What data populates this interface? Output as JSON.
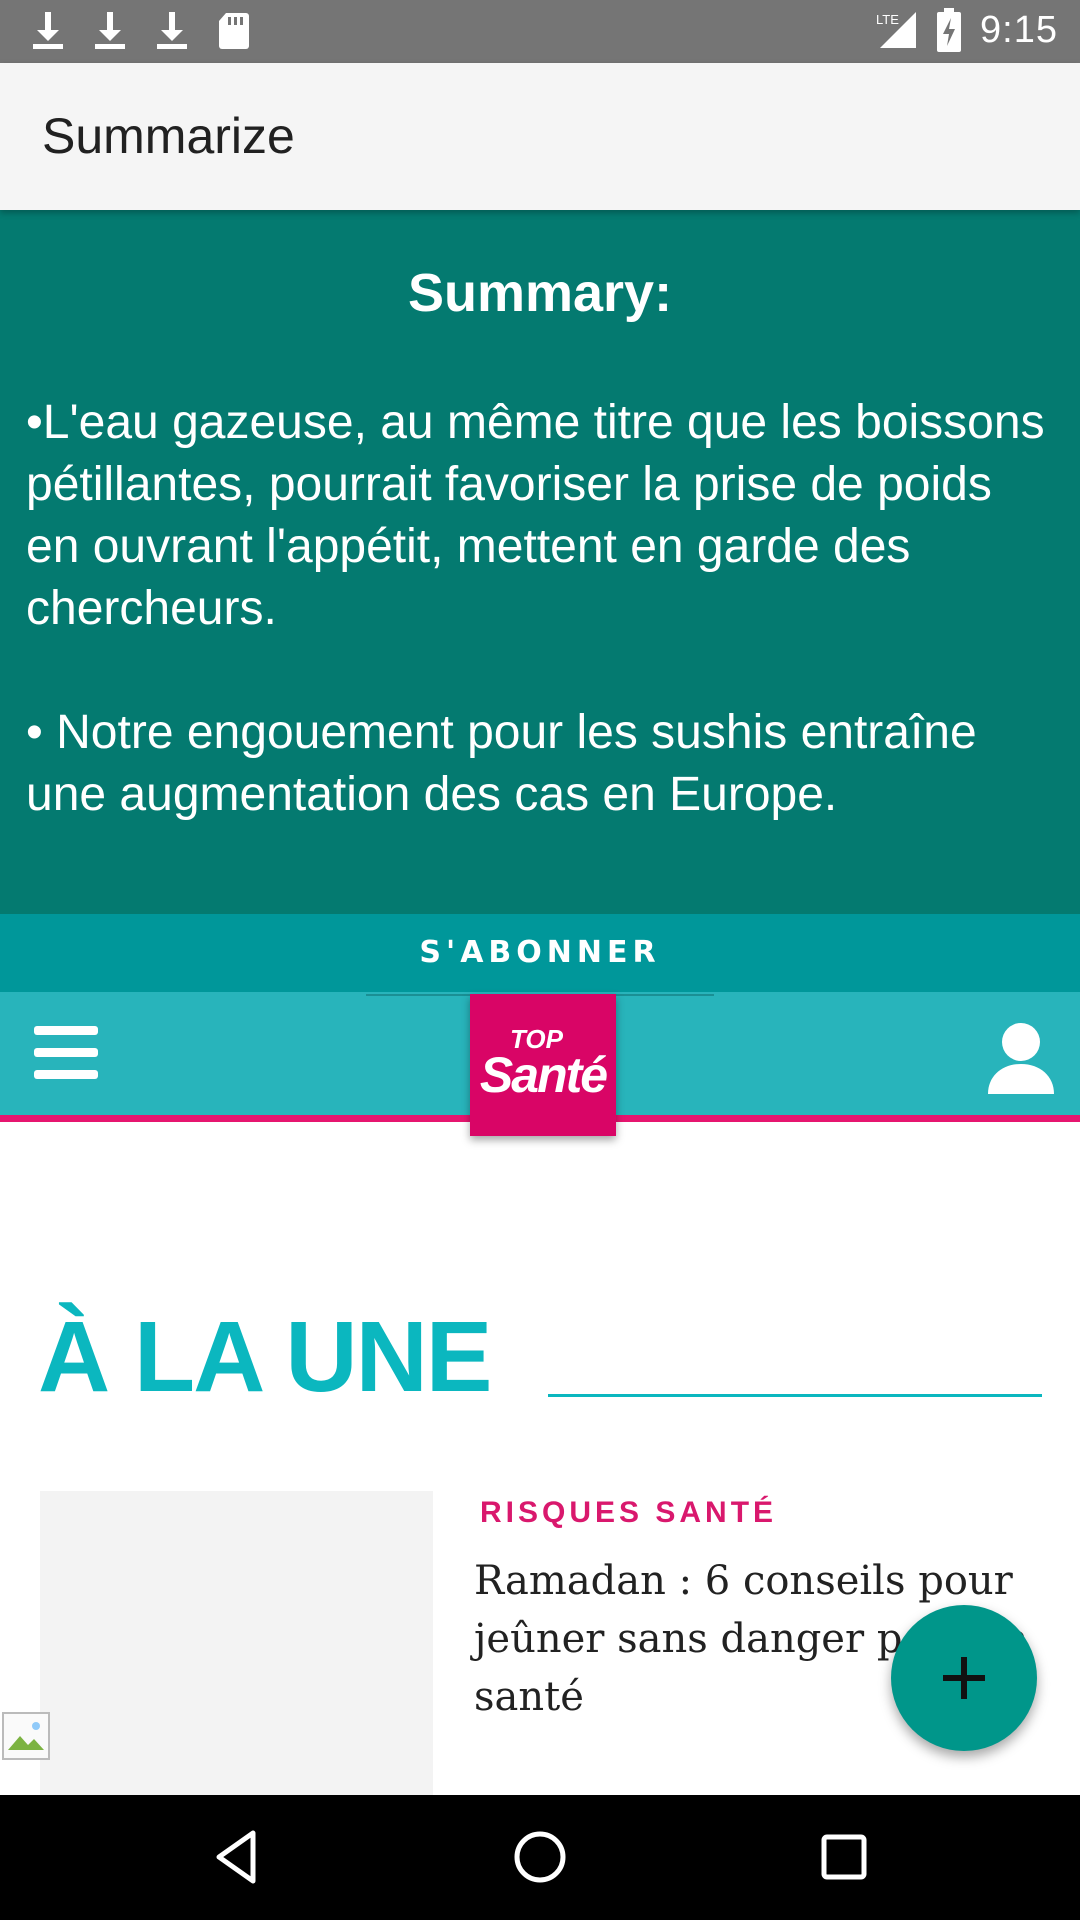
{
  "status_bar": {
    "time": "9:15",
    "network": "LTE",
    "icons": [
      "download-icon",
      "download-icon",
      "download-icon",
      "sd-card-icon",
      "signal-icon",
      "battery-charging-icon"
    ]
  },
  "app_bar": {
    "title": "Summarize"
  },
  "summary": {
    "heading": "Summary:",
    "bullets": [
      "•L'eau gazeuse, au même titre que les boissons pétillantes, pourrait favoriser la prise de poids en ouvrant l'appétit, mettent en garde des chercheurs.",
      " • Notre engouement pour les sushis entraîne une augmentation des cas en Europe."
    ]
  },
  "webpage": {
    "subscribe_label": "S'ABONNER",
    "logo_top": "TOP",
    "logo_brand": "Santé",
    "section_title": "À LA UNE",
    "article": {
      "category": "RISQUES SANTÉ",
      "title": "Ramadan : 6 conseils pour jeûner sans danger pour sa santé"
    }
  },
  "colors": {
    "summary_bg": "#047a70",
    "subscribe_bg": "#00979a",
    "header_bg": "#28b4bb",
    "accent_pink": "#e6156f",
    "fab_bg": "#00968a"
  }
}
